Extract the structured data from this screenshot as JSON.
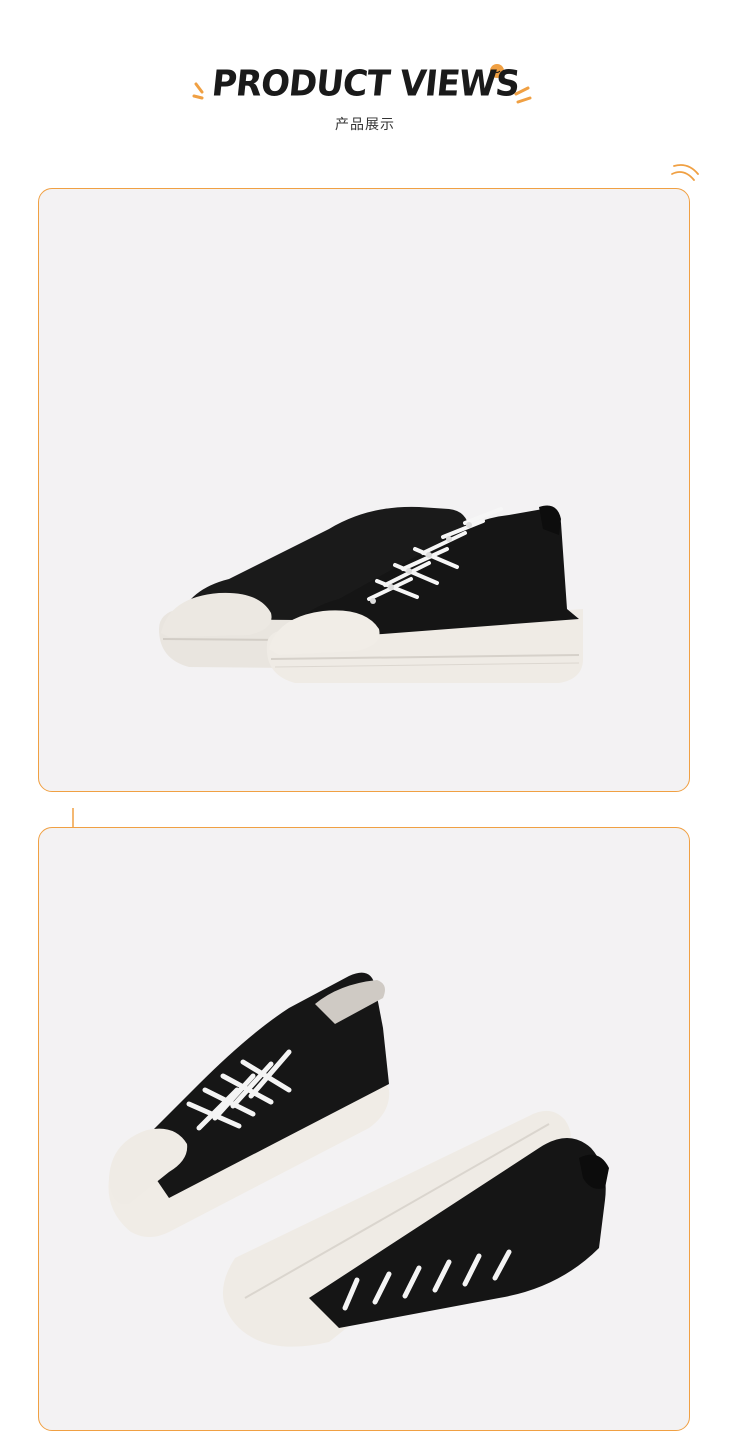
{
  "header": {
    "title": "PRODUCT VIEWS",
    "subtitle": "产品展示"
  },
  "views": [
    {
      "caption": "",
      "accent": "#f0a043"
    },
    {
      "caption": "",
      "accent": "#f0a043"
    }
  ],
  "colors": {
    "accent": "#f0a043",
    "frame_bg": "#f3f2f3",
    "shoe_black": "#151515",
    "sole_white": "#eeeae4"
  }
}
